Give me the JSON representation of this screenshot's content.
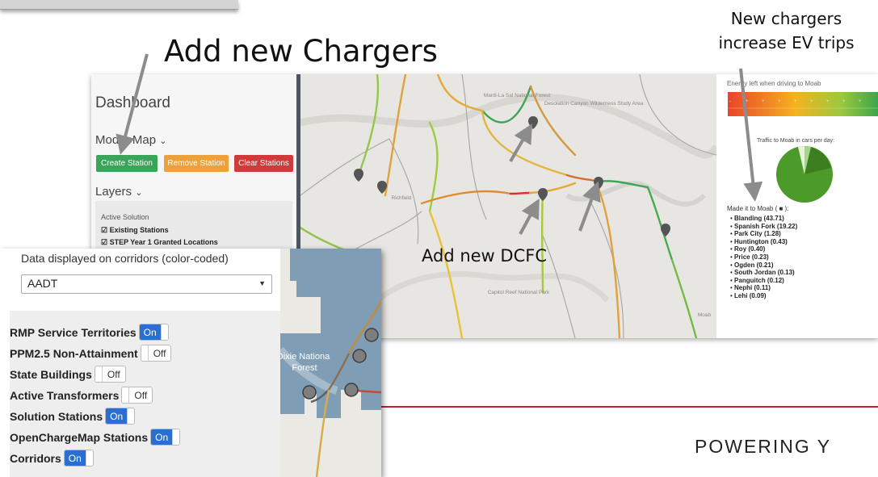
{
  "annotations": {
    "add_chargers": "Add new Chargers",
    "new_chargers_line1": "New chargers",
    "new_chargers_line2": "increase EV trips",
    "add_dcfc": "Add new DCFC"
  },
  "footer": {
    "text": "POWERING Y",
    "line_color": "#c41e2a"
  },
  "dashboard": {
    "title": "Dashboard",
    "mode_map_label": "Mode: Map",
    "buttons": {
      "create": "Create Station",
      "remove": "Remove Station",
      "clear": "Clear Stations"
    },
    "button_colors": {
      "create": "#3aa55a",
      "remove": "#eca13c",
      "clear": "#d03a3a"
    },
    "layers_label": "Layers",
    "active_solution_label": "Active Solution",
    "checks": [
      "Existing Stations",
      "STEP Year 1 Granted Locations"
    ]
  },
  "map1": {
    "labels": [
      {
        "text": "Manti-La Sal National Forest"
      },
      {
        "text": "Desolation Canyon Wilderness Study Area"
      },
      {
        "text": "Capitol Reef National Park"
      },
      {
        "text": "Richfield"
      },
      {
        "text": "Moab"
      }
    ]
  },
  "energy_panel": {
    "title": "Energy left when driving to Moab",
    "traffic_title": "Traffic to Moab in cars per day:",
    "made_it_label": "Made it to Moab ( ■ ):",
    "destinations": [
      "Blanding (43.71)",
      "Spanish Fork (19.22)",
      "Park City (1.28)",
      "Huntington (0.43)",
      "Roy (0.40)",
      "Price (0.23)",
      "Ogden (0.21)",
      "South Jordan (0.13)",
      "Panguitch (0.12)",
      "Nephi (0.11)",
      "Lehi (0.09)"
    ]
  },
  "layer_panel": {
    "corridor_label": "Data displayed on corridors (color-coded)",
    "select_value": "AADT",
    "toggles": [
      {
        "label": "RMP Service Territories",
        "state": "On"
      },
      {
        "label": "PPM2.5 Non-Attainment",
        "state": "Off"
      },
      {
        "label": "State Buildings",
        "state": "Off"
      },
      {
        "label": "Active Transformers",
        "state": "Off"
      },
      {
        "label": "Solution Stations",
        "state": "On"
      },
      {
        "label": "OpenChargeMap Stations",
        "state": "On"
      },
      {
        "label": "Corridors",
        "state": "On"
      }
    ]
  },
  "map2": {
    "forest_label": "Dixie National Forest"
  },
  "colors": {
    "toggle_on": "#2a6fd0",
    "sidebar_divider": "#4a5566",
    "map2_territory": "#7f9db4"
  }
}
